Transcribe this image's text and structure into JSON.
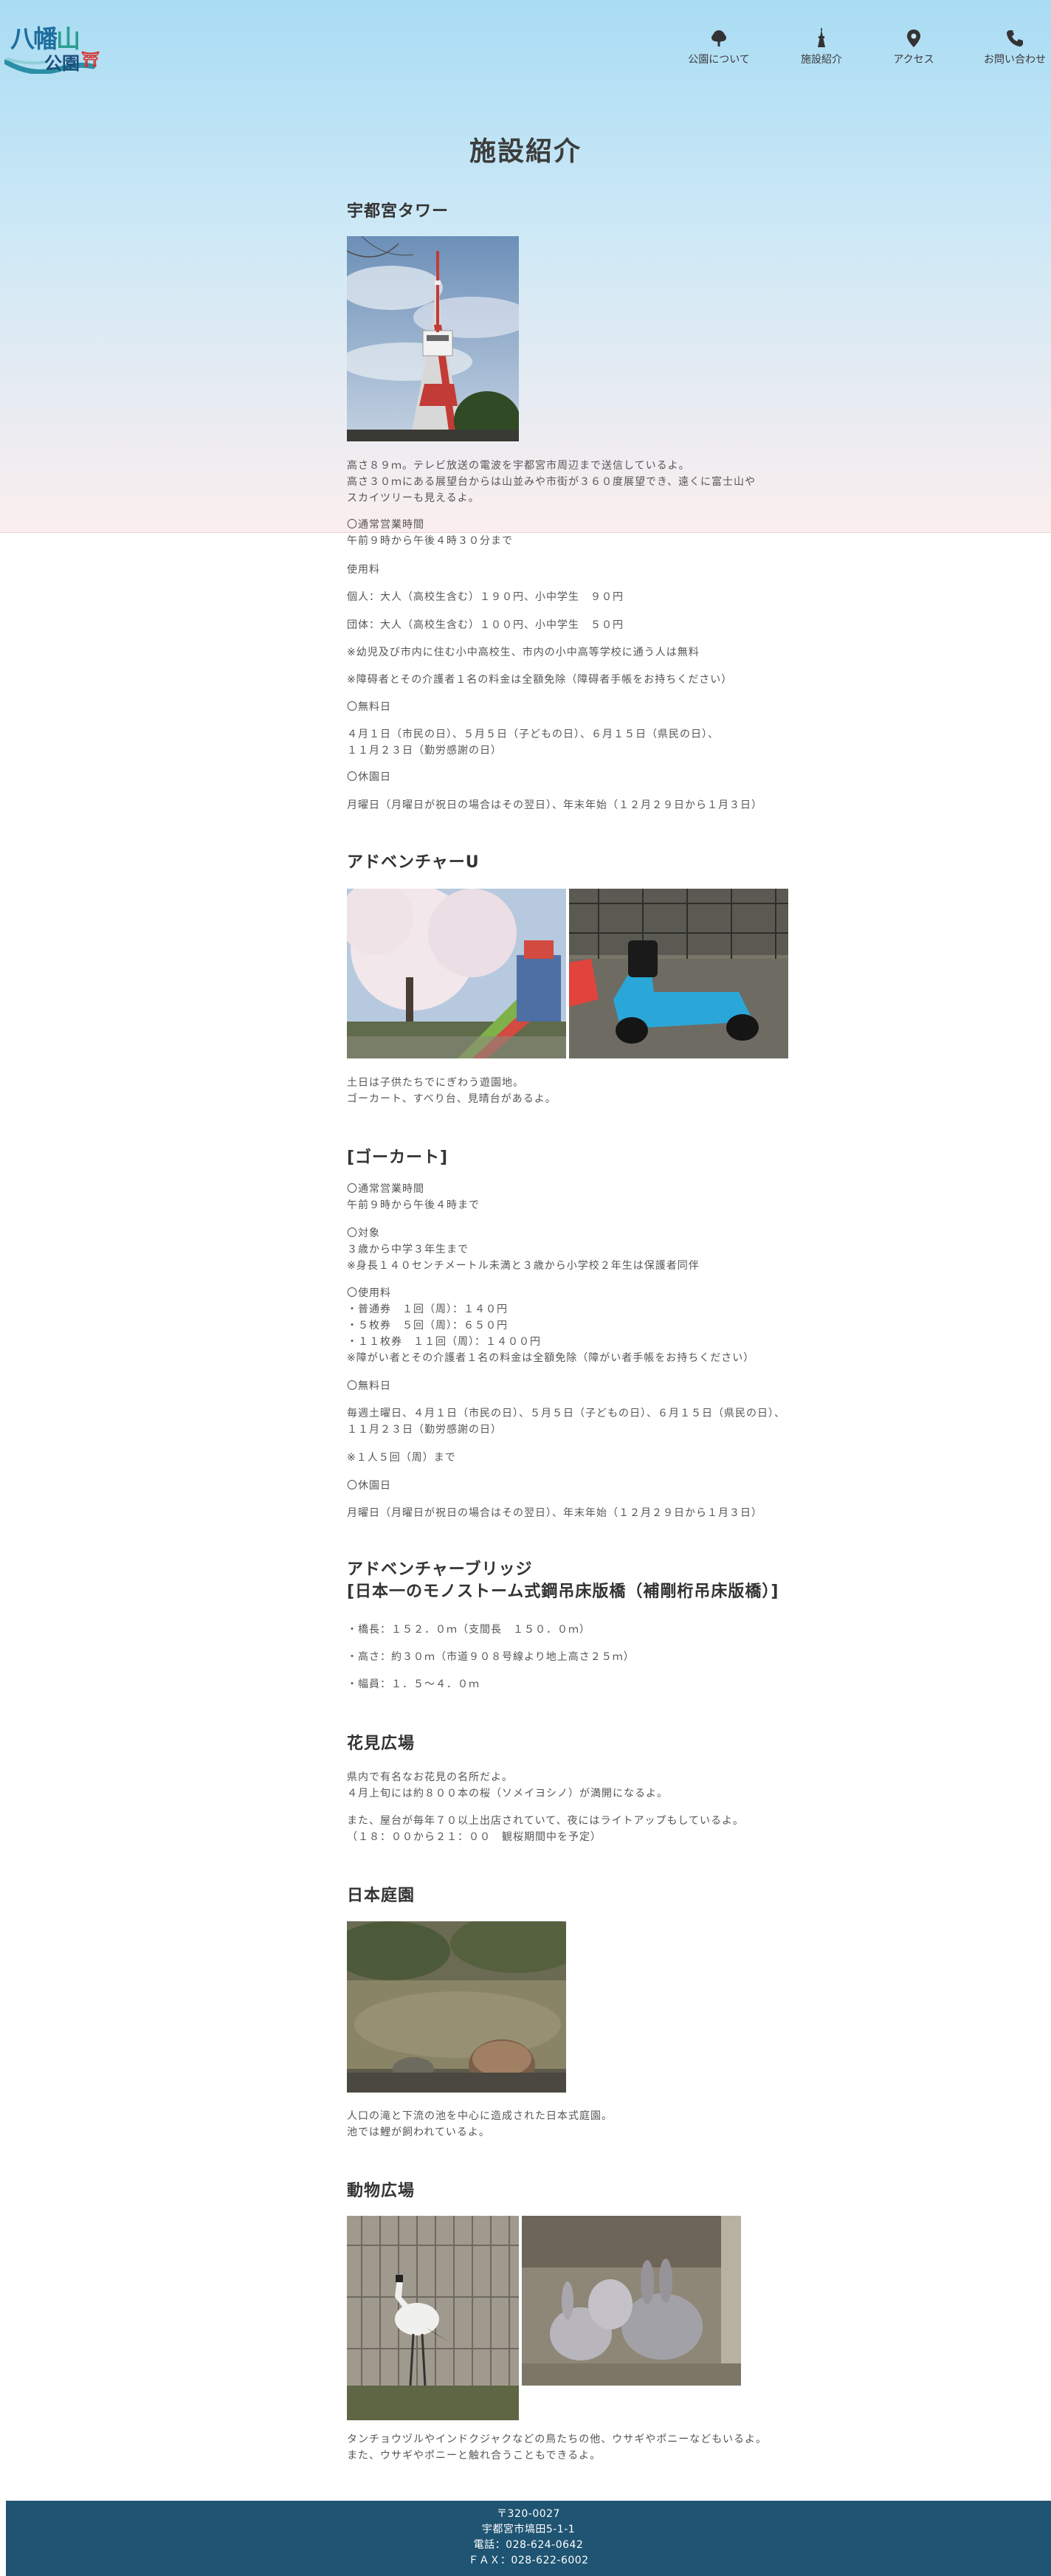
{
  "logo": {
    "line1_a": "八幡",
    "line1_b": "山",
    "line2": "公園",
    "mark": "⛩"
  },
  "nav": [
    {
      "label": "公園について",
      "icon": "tree-icon"
    },
    {
      "label": "施設紹介",
      "icon": "tower-icon"
    },
    {
      "label": "アクセス",
      "icon": "map-pin-icon"
    },
    {
      "label": "お問い合わせ",
      "icon": "phone-icon"
    }
  ],
  "page_title": "施設紹介",
  "tower": {
    "title": "宇都宮タワー",
    "desc": [
      "高さ８９ｍ。テレビ放送の電波を宇都宮市周辺まで送信しているよ。",
      "高さ３０ｍにある展望台からは山並みや市街が３６０度展望でき、遠くに富士山や",
      "スカイツリーも見えるよ。"
    ],
    "hours_head": "〇通常営業時間",
    "hours": "午前９時から午後４時３０分まで",
    "fee_head": "使用料",
    "fee_individual": "個人：大人（高校生含む）１９０円、小中学生　９０円",
    "fee_group": "団体：大人（高校生含む）１００円、小中学生　５０円",
    "note_free_kids": "※幼児及び市内に住む小中高校生、市内の小中高等学校に通う人は無料",
    "note_disabled": "※障碍者とその介護者１名の料金は全額免除（障碍者手帳をお持ちください）",
    "free_head": "〇無料日",
    "free_days": [
      "４月１日（市民の日）、５月５日（子どもの日）、６月１５日（県民の日）、",
      "１１月２３日（勤労感謝の日）"
    ],
    "closed_head": "〇休園日",
    "closed": "月曜日（月曜日が祝日の場合はその翌日）、年末年始（１２月２９日から１月３日）"
  },
  "adventure_u": {
    "title": "アドベンチャーU",
    "desc": [
      "土日は子供たちでにぎわう遊園地。",
      "ゴーカート、すべり台、見晴台があるよ。"
    ]
  },
  "gokart": {
    "title": "[ゴーカート]",
    "hours_head": "〇通常営業時間",
    "hours": "午前９時から午後４時まで",
    "target_head": "〇対象",
    "target": [
      "３歳から中学３年生まで",
      "※身長１４０センチメートル未満と３歳から小学校２年生は保護者同伴"
    ],
    "fee_head": "〇使用料",
    "fee": [
      "・普通券　１回（周）：１４０円",
      "・５枚券　５回（周）：６５０円",
      "・１１枚券　１１回（周）：１４００円",
      "※障がい者とその介護者１名の料金は全額免除（障がい者手帳をお持ちください）"
    ],
    "free_head": "〇無料日",
    "free_days": [
      "毎週土曜日、４月１日（市民の日）、５月５日（子どもの日）、６月１５日（県民の日）、",
      "１１月２３日（勤労感謝の日）"
    ],
    "limit": "※１人５回（周）まで",
    "closed_head": "〇休園日",
    "closed": "月曜日（月曜日が祝日の場合はその翌日）、年末年始（１２月２９日から１月３日）"
  },
  "bridge": {
    "title1": "アドベンチャーブリッジ",
    "title2": "[日本一のモノストーム式鋼吊床版橋（補剛桁吊床版橋）]",
    "length": "・橋長：１５２．０ｍ（支間長　１５０．０ｍ）",
    "height": "・高さ：約３０ｍ（市道９０８号線より地上高さ２５ｍ）",
    "width": "・幅員：１．５～４．０ｍ"
  },
  "hanami": {
    "title": "花見広場",
    "desc1": [
      "県内で有名なお花見の名所だよ。",
      "４月上旬には約８００本の桜（ソメイヨシノ）が満開になるよ。"
    ],
    "desc2": [
      "また、屋台が毎年７０以上出店されていて、夜にはライトアップもしているよ。",
      "（１８：００から２１：００　観桜期間中を予定）"
    ]
  },
  "garden": {
    "title": "日本庭園",
    "desc": [
      "人口の滝と下流の池を中心に造成された日本式庭園。",
      "池では鯉が飼われているよ。"
    ]
  },
  "zoo": {
    "title": "動物広場",
    "desc": [
      "タンチョウヅルやインドクジャクなどの鳥たちの他、ウサギやポニーなどもいるよ。",
      "また、ウサギやポニーと触れ合うこともできるよ。"
    ]
  },
  "footer": {
    "zip": "〒320-0027",
    "address": "宇都宮市塙田5-1-1",
    "tel": "電話：028-624-0642",
    "fax": "ＦＡＸ：028-622-6002"
  }
}
